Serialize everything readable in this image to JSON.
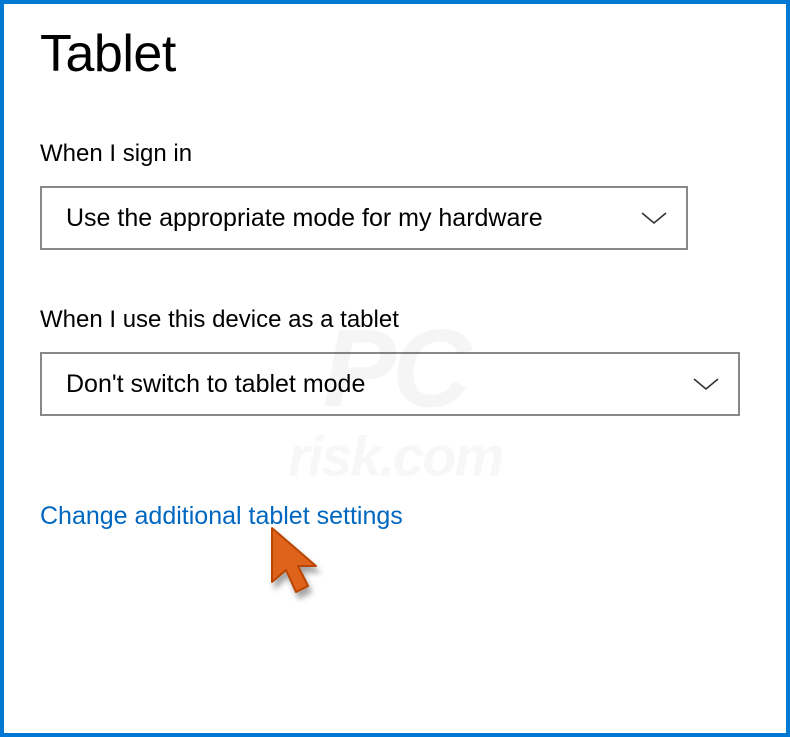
{
  "page": {
    "title": "Tablet"
  },
  "sections": {
    "signin": {
      "label": "When I sign in",
      "dropdown_value": "Use the appropriate mode for my hardware"
    },
    "use_as_tablet": {
      "label": "When I use this device as a tablet",
      "dropdown_value": "Don't switch to tablet mode"
    }
  },
  "link": {
    "label": "Change additional tablet settings"
  },
  "watermark": {
    "main": "PC",
    "sub": "risk.com"
  }
}
